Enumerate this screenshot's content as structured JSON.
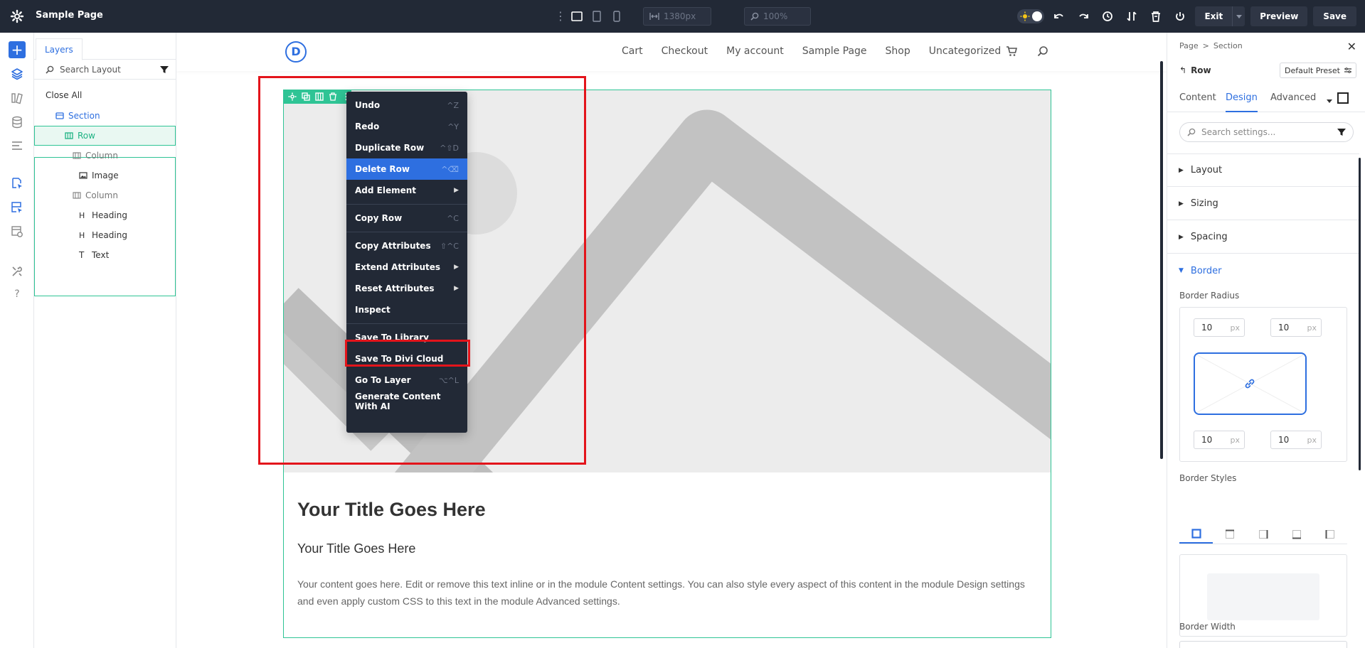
{
  "topbar": {
    "title": "Sample Page",
    "width_placeholder": "1380px",
    "zoom_placeholder": "100%",
    "exit_label": "Exit",
    "preview_label": "Preview",
    "save_label": "Save"
  },
  "layers": {
    "tab_label": "Layers",
    "search_placeholder": "Search Layout",
    "close_all": "Close All",
    "items": [
      {
        "label": "Section",
        "type": "section"
      },
      {
        "label": "Row",
        "type": "row"
      },
      {
        "label": "Column",
        "type": "column"
      },
      {
        "label": "Image",
        "type": "image"
      },
      {
        "label": "Column",
        "type": "column"
      },
      {
        "label": "Heading",
        "type": "heading"
      },
      {
        "label": "Heading",
        "type": "heading"
      },
      {
        "label": "Text",
        "type": "text"
      }
    ]
  },
  "site": {
    "logo": "D",
    "nav": [
      "Cart",
      "Checkout",
      "My account",
      "Sample Page",
      "Shop",
      "Uncategorized"
    ],
    "heading1": "Your Title Goes Here",
    "heading2": "Your Title Goes Here",
    "body_text": "Your content goes here. Edit or remove this text inline or in the module Content settings. You can also style every aspect of this content in the module Design settings and even apply custom CSS to this text in the module Advanced settings."
  },
  "context_menu": {
    "items": [
      {
        "label": "Undo",
        "shortcut": "^Z"
      },
      {
        "label": "Redo",
        "shortcut": "^Y"
      },
      {
        "label": "Duplicate Row",
        "shortcut": "^⇧D"
      },
      {
        "label": "Delete Row",
        "shortcut": "^⌫"
      },
      {
        "label": "Add Element",
        "shortcut": "▶"
      },
      {
        "label": "Copy Row",
        "shortcut": "^C"
      },
      {
        "label": "Copy Attributes",
        "shortcut": "⇧^C"
      },
      {
        "label": "Extend Attributes",
        "shortcut": "▶"
      },
      {
        "label": "Reset Attributes",
        "shortcut": "▶"
      },
      {
        "label": "Inspect",
        "shortcut": ""
      },
      {
        "label": "Save To Library",
        "shortcut": ""
      },
      {
        "label": "Save To Divi Cloud",
        "shortcut": ""
      },
      {
        "label": "Go To Layer",
        "shortcut": "⌥^L"
      },
      {
        "label": "Generate Content With AI",
        "shortcut": ""
      }
    ],
    "active": "Delete Row",
    "highlighted": "Save To Library"
  },
  "settings": {
    "breadcrumb": [
      "Page",
      ">",
      "Section"
    ],
    "element": "Row",
    "preset": "Default Preset",
    "tabs": [
      "Content",
      "Design",
      "Advanced"
    ],
    "active_tab": "Design",
    "search_placeholder": "Search settings...",
    "sections": [
      "Layout",
      "Sizing",
      "Spacing",
      "Border"
    ],
    "open_section": "Border",
    "border_radius_label": "Border Radius",
    "radius": {
      "tl": "10",
      "tr": "10",
      "bl": "10",
      "br": "10",
      "unit": "px"
    },
    "border_styles_label": "Border Styles",
    "border_width_label": "Border Width"
  },
  "colors": {
    "accent": "#2e6fe0",
    "builder_green": "#2fc495",
    "dark": "#222936",
    "highlight_red": "#e3141b"
  }
}
